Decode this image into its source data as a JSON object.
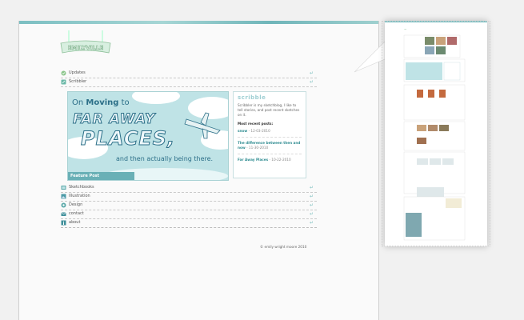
{
  "logo": {
    "text": "EMILYVILLE"
  },
  "nav_top": [
    {
      "label": "Updates",
      "icon": "updates-icon"
    },
    {
      "label": "Scribbler",
      "icon": "scribbler-icon"
    }
  ],
  "feature": {
    "line1_pre": "On ",
    "line1_bold": "Moving",
    "line1_post": " to",
    "line2": "FAR AWAY",
    "line3": "PLACES,",
    "line4": "and then actually being there.",
    "badge": "Feature Post"
  },
  "sidebar": {
    "heading": "scribble",
    "description": "Scribbler is my sketchblog, I like to tell stories, and post recent sketches on it.",
    "recent_label": "Most recent posts:",
    "posts": [
      {
        "title": "snow",
        "date": " - 12-03-2010"
      },
      {
        "title": "The difference between then and now",
        "date": " - 11-30-2010"
      },
      {
        "title": "Far Away Places",
        "date": " - 10-22-2010"
      }
    ]
  },
  "nav_bottom": [
    {
      "label": "Sketchbooks",
      "icon": "sketchbook-icon"
    },
    {
      "label": "Illustration",
      "icon": "illustration-icon"
    },
    {
      "label": "Design",
      "icon": "design-icon"
    },
    {
      "label": "contact",
      "icon": "contact-icon"
    },
    {
      "label": "about",
      "icon": "about-icon"
    }
  ],
  "footer": {
    "text": "© emily wright moore 2010"
  },
  "colors": {
    "accent": "#7bbfbf",
    "dark_teal": "#2c6f88",
    "sky": "#bfe3e6"
  }
}
